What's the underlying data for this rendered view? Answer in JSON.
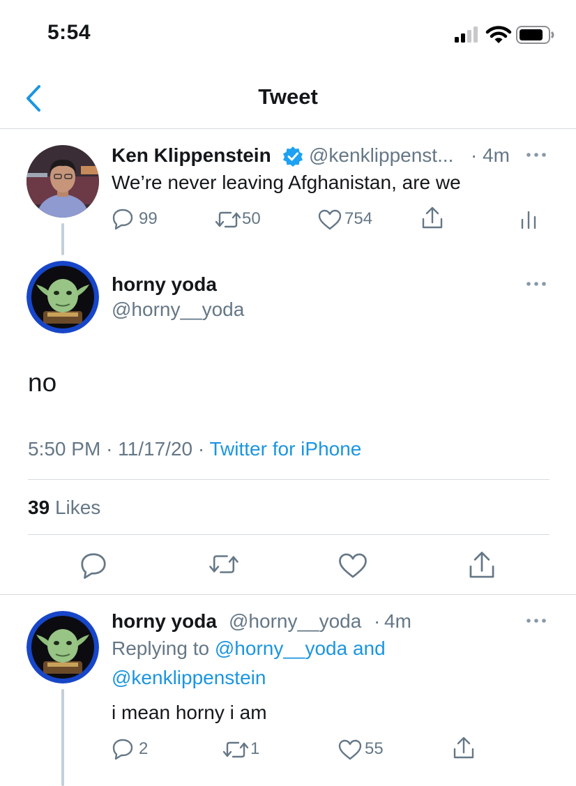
{
  "status_bar": {
    "time": "5:54"
  },
  "nav": {
    "title": "Tweet"
  },
  "parent_tweet": {
    "author_name": "Ken Klippenstein",
    "handle": "@kenklippenst...",
    "separator": "·",
    "time": "4m",
    "text": "We’re never leaving Afghanistan, are we",
    "replies": "99",
    "retweets": "50",
    "likes": "754"
  },
  "main_tweet": {
    "author_name": "horny yoda",
    "handle": "@horny__yoda",
    "text": "no",
    "time": "5:50 PM",
    "date": "11/17/20",
    "separator": "·",
    "source": "Twitter for iPhone",
    "likes_count": "39",
    "likes_label": "Likes"
  },
  "reply_tweet": {
    "author_name": "horny yoda",
    "handle": "@horny__yoda",
    "separator": "·",
    "time": "4m",
    "replying_prefix": "Replying to",
    "replying_users": "@horny__yoda and",
    "replying_users_2": "@kenklippenstein",
    "text": "i mean horny i am",
    "replies": "2",
    "retweets": "1",
    "likes": "55"
  },
  "colors": {
    "accent": "#1b95e0",
    "secondary_text": "#657786",
    "divider": "#d6dbdf",
    "verified": "#1da1f2"
  }
}
